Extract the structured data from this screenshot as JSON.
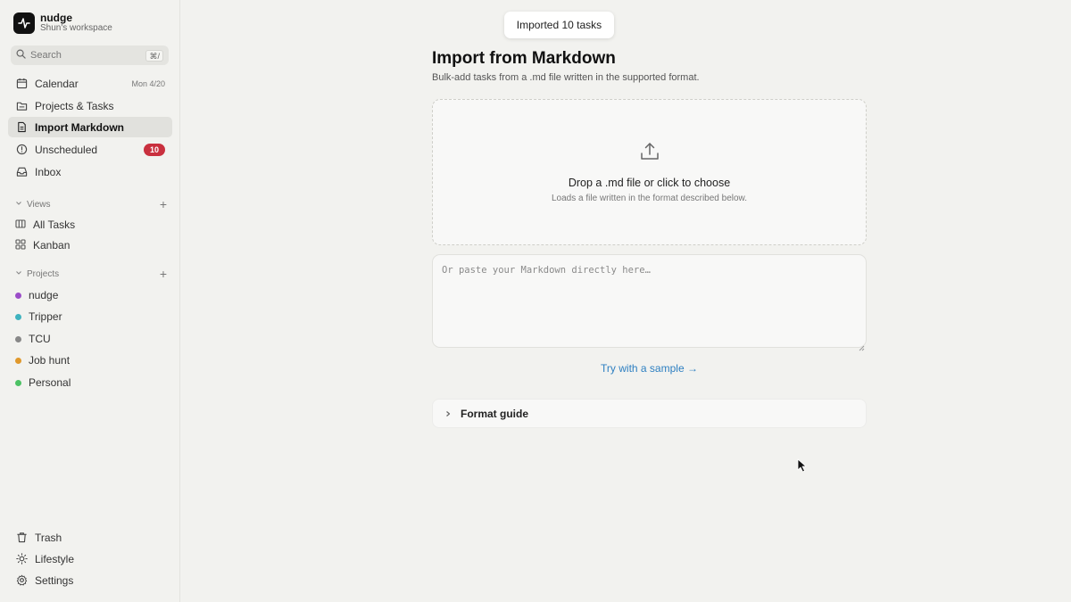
{
  "app": {
    "name": "nudge",
    "workspace": "Shun's workspace",
    "logo_icon": "activity-pulse-icon"
  },
  "search": {
    "label": "Search",
    "shortcut": "⌘/"
  },
  "nav": [
    {
      "label": "Calendar",
      "meta": "Mon 4/20",
      "icon": "calendar-icon"
    },
    {
      "label": "Projects & Tasks",
      "icon": "folder-icon"
    },
    {
      "label": "Import Markdown",
      "icon": "document-icon",
      "active": true
    },
    {
      "label": "Unscheduled",
      "badge": "10",
      "icon": "clock-icon"
    },
    {
      "label": "Inbox",
      "icon": "inbox-icon"
    }
  ],
  "views": {
    "heading": "Views",
    "items": [
      {
        "label": "All Tasks",
        "icon": "columns-icon"
      },
      {
        "label": "Kanban",
        "icon": "grid-icon"
      }
    ]
  },
  "projects": {
    "heading": "Projects",
    "items": [
      {
        "label": "nudge",
        "color": "#9b4dc8"
      },
      {
        "label": "Tripper",
        "color": "#3fb3bf"
      },
      {
        "label": "TCU",
        "color": "#888888"
      },
      {
        "label": "Job hunt",
        "color": "#e0982b"
      },
      {
        "label": "Personal",
        "color": "#4cc264"
      }
    ]
  },
  "footer_nav": [
    {
      "label": "Trash",
      "icon": "trash-icon"
    },
    {
      "label": "Lifestyle",
      "icon": "sun-icon"
    },
    {
      "label": "Settings",
      "icon": "gear-icon"
    }
  ],
  "toast": {
    "text": "Imported 10 tasks"
  },
  "main": {
    "title": "Import from Markdown",
    "subtitle": "Bulk-add tasks from a .md file written in the supported format.",
    "dropzone": {
      "title": "Drop a .md file or click to choose",
      "subtitle": "Loads a file written in the format described below.",
      "icon": "upload-icon"
    },
    "paste": {
      "placeholder": "Or paste your Markdown directly here…",
      "value": ""
    },
    "sample_link": "Try with a sample →",
    "format_guide": "Format guide"
  },
  "colors": {
    "accent_link": "#2d7fc1",
    "badge": "#c9303e",
    "active_nav_bg": "#e1e1dd"
  }
}
